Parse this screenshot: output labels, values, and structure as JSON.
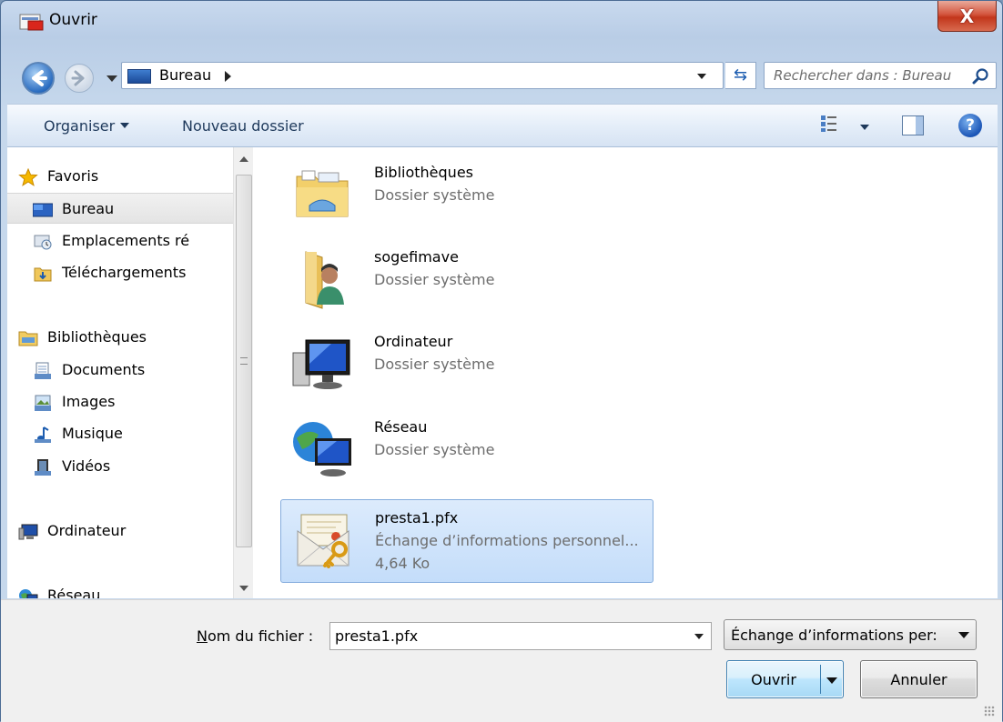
{
  "window": {
    "title": "Ouvrir",
    "close_label": "X"
  },
  "address_bar": {
    "crumb": "Bureau",
    "search_placeholder": "Rechercher dans : Bureau"
  },
  "toolbar": {
    "organize_label": "Organiser",
    "new_folder_label": "Nouveau dossier",
    "help_label": "?"
  },
  "sidebar": {
    "items": [
      {
        "label": "Favoris",
        "icon": "star-icon"
      },
      {
        "label": "Bureau",
        "icon": "desktop-icon"
      },
      {
        "label": "Emplacements ré",
        "icon": "recent-places-icon"
      },
      {
        "label": "Téléchargements",
        "icon": "downloads-icon"
      },
      {
        "label": "Bibliothèques",
        "icon": "libraries-icon"
      },
      {
        "label": "Documents",
        "icon": "documents-icon"
      },
      {
        "label": "Images",
        "icon": "images-icon"
      },
      {
        "label": "Musique",
        "icon": "music-icon"
      },
      {
        "label": "Vidéos",
        "icon": "videos-icon"
      },
      {
        "label": "Ordinateur",
        "icon": "computer-icon"
      },
      {
        "label": "Réseau",
        "icon": "network-icon"
      }
    ]
  },
  "files": [
    {
      "name": "Bibliothèques",
      "type": "Dossier système",
      "icon": "libraries-folder-icon"
    },
    {
      "name": "sogefimave",
      "type": "Dossier système",
      "icon": "user-folder-icon"
    },
    {
      "name": "Ordinateur",
      "type": "Dossier système",
      "icon": "computer-icon"
    },
    {
      "name": "Réseau",
      "type": "Dossier système",
      "icon": "network-icon"
    },
    {
      "name": "presta1.pfx",
      "type": "Échange d’informations personnel...",
      "size": "4,64 Ko",
      "icon": "certificate-icon"
    }
  ],
  "bottom": {
    "filename_label_underlined": "N",
    "filename_label_rest": "om du fichier :",
    "filename_value": "presta1.pfx",
    "filter_value": "Échange d’informations per:",
    "open_label": "Ouvrir",
    "cancel_label": "Annuler"
  },
  "colors": {
    "selection": "#c4ddfa",
    "accent": "#1b55b6",
    "close": "#c2361b"
  }
}
